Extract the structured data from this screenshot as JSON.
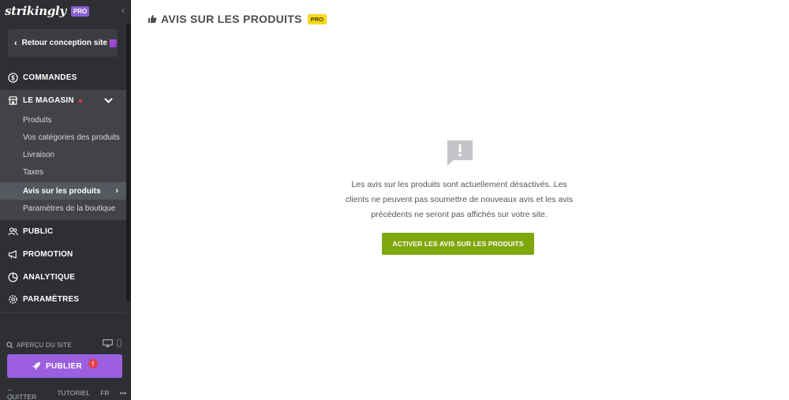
{
  "sidebar": {
    "logo": "strikingly",
    "logo_badge": "PRO",
    "back_label": "Retour conception site",
    "nav": {
      "orders": "COMMANDES",
      "store": "LE MAGASIN",
      "audience": "PUBLIC",
      "promotion": "PROMOTION",
      "analytics": "ANALYTIQUE",
      "settings": "PARAMÈTRES"
    },
    "store_items": [
      {
        "label": "Produits"
      },
      {
        "label": "Vos catégories des produits"
      },
      {
        "label": "Livraison"
      },
      {
        "label": "Taxes"
      },
      {
        "label": "Avis sur les produits",
        "active": true
      },
      {
        "label": "Paramètres de la boutique"
      }
    ],
    "preview_label": "APERÇU DU SITE",
    "publish_label": "PUBLIER",
    "publish_badge": "!",
    "footer": {
      "quit": "QUITTER",
      "tutorial": "TUTORIEL",
      "language": "FR",
      "more": "•••"
    }
  },
  "main": {
    "title": "AVIS SUR LES PRODUITS",
    "title_badge": "PRO",
    "empty_message": "Les avis sur les produits sont actuellement désactivés. Les clients ne peuvent pas soumettre de nouveaux avis et les avis précédents ne seront pas affichés sur votre site.",
    "enable_button": "ACTIVER LES AVIS SUR LES PRODUITS"
  },
  "colors": {
    "sidebar_bg": "#2d2f33",
    "store_bg": "#414347",
    "publish": "#9b5fe0",
    "enable_button": "#7fa80f",
    "pro_chip": "#f6d91a"
  }
}
